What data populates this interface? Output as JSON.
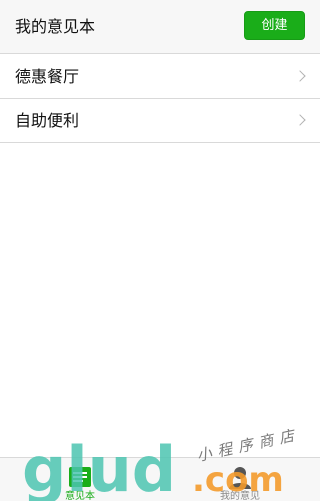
{
  "header": {
    "title": "我的意见本",
    "create_label": "创建"
  },
  "list": {
    "items": [
      {
        "label": "德惠餐厅",
        "icon": "chevron-right-icon"
      },
      {
        "label": "自助便利",
        "icon": "chevron-right-icon"
      }
    ]
  },
  "tabbar": {
    "tabs": [
      {
        "label": "意见本",
        "icon": "notebook-icon",
        "active": true
      },
      {
        "label": "我的意见",
        "icon": "person-icon",
        "active": false
      }
    ]
  },
  "watermark": {
    "brand": "glud",
    "tld": ".com",
    "tagline": "小程序商店"
  },
  "colors": {
    "accent": "#1aad19",
    "header_bg": "#f7f7f7",
    "divider": "#d9d9d9",
    "watermark_teal": "#4cc4b0",
    "watermark_orange": "#f39a2b"
  }
}
